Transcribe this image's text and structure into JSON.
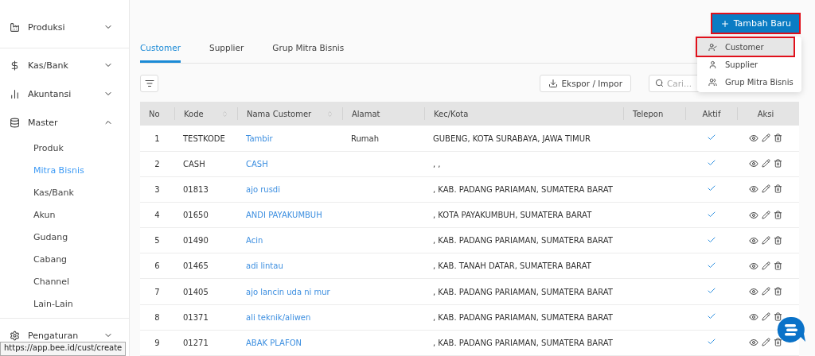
{
  "sidebar": {
    "items": [
      {
        "label": "Produksi",
        "expanded": false
      },
      {
        "label": "Kas/Bank",
        "expanded": false
      },
      {
        "label": "Akuntansi",
        "expanded": false
      },
      {
        "label": "Master",
        "expanded": true,
        "children": [
          {
            "label": "Produk",
            "selected": false
          },
          {
            "label": "Mitra Bisnis",
            "selected": true
          },
          {
            "label": "Kas/Bank",
            "selected": false
          },
          {
            "label": "Akun",
            "selected": false
          },
          {
            "label": "Gudang",
            "selected": false
          },
          {
            "label": "Cabang",
            "selected": false
          },
          {
            "label": "Channel",
            "selected": false
          },
          {
            "label": "Lain-Lain",
            "selected": false
          }
        ]
      },
      {
        "label": "Pengaturan",
        "expanded": false
      }
    ]
  },
  "status_url": "https://app.bee.id/cust/create",
  "add_button": {
    "label": "Tambah Baru",
    "highlighted": true
  },
  "add_menu": [
    {
      "label": "Customer",
      "highlighted": true
    },
    {
      "label": "Supplier",
      "highlighted": false
    },
    {
      "label": "Grup Mitra Bisnis",
      "highlighted": false
    }
  ],
  "tabs": [
    {
      "label": "Customer",
      "selected": true
    },
    {
      "label": "Supplier",
      "selected": false
    },
    {
      "label": "Grup Mitra Bisnis",
      "selected": false
    }
  ],
  "export_button": "Ekspor / Impor",
  "search": {
    "placeholder": "Cari..."
  },
  "table": {
    "columns": [
      {
        "label": "No",
        "sortable": false
      },
      {
        "label": "Kode",
        "sortable": true
      },
      {
        "label": "Nama Customer",
        "sortable": true
      },
      {
        "label": "Alamat",
        "sortable": false
      },
      {
        "label": "Kec/Kota",
        "sortable": false
      },
      {
        "label": "Telepon",
        "sortable": false
      },
      {
        "label": "Aktif",
        "sortable": false
      },
      {
        "label": "Aksi",
        "sortable": false
      }
    ],
    "rows": [
      {
        "no": "1",
        "kode": "TESTKODE",
        "nama": "Tambir",
        "alamat": "Rumah",
        "kota": "GUBENG, KOTA SURABAYA, JAWA TIMUR",
        "active": true
      },
      {
        "no": "2",
        "kode": "CASH",
        "nama": "CASH",
        "kota": ", ,",
        "active": true
      },
      {
        "no": "3",
        "kode": "01813",
        "nama": "ajo rusdi",
        "kota": ", KAB. PADANG PARIAMAN, SUMATERA BARAT",
        "active": true
      },
      {
        "no": "4",
        "kode": "01650",
        "nama": "ANDI PAYAKUMBUH",
        "kota": ", KOTA PAYAKUMBUH, SUMATERA BARAT",
        "active": true
      },
      {
        "no": "5",
        "kode": "01490",
        "nama": "Acin",
        "kota": ", KAB. PADANG PARIAMAN, SUMATERA BARAT",
        "active": true
      },
      {
        "no": "6",
        "kode": "01465",
        "nama": "adi lintau",
        "kota": ", KAB. TANAH DATAR, SUMATERA BARAT",
        "active": true
      },
      {
        "no": "7",
        "kode": "01405",
        "nama": "ajo lancin uda ni mur",
        "kota": ", KAB. PADANG PARIAMAN, SUMATERA BARAT",
        "active": true
      },
      {
        "no": "8",
        "kode": "01371",
        "nama": "ali teknik/aliwen",
        "kota": ", KAB. PADANG PARIAMAN, SUMATERA BARAT",
        "active": true
      },
      {
        "no": "9",
        "kode": "01271",
        "nama": "ABAK PLAFON",
        "kota": ", KAB. PADANG PARIAMAN, SUMATERA BARAT",
        "active": true
      }
    ]
  }
}
